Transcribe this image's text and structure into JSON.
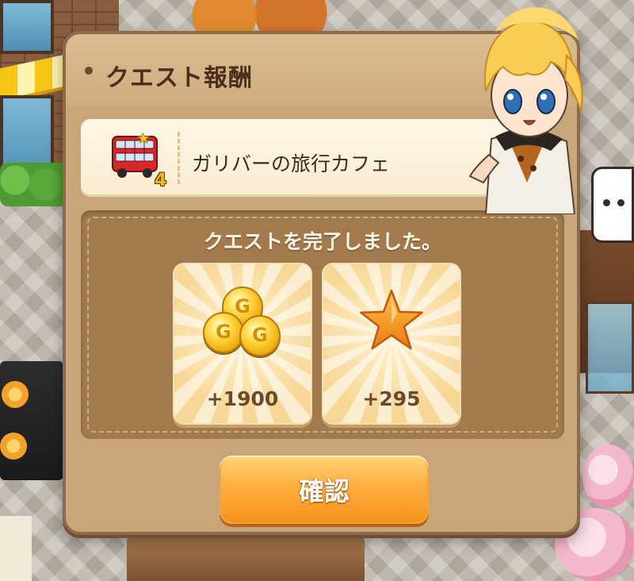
{
  "dialog": {
    "title": "クエスト報酬",
    "building": {
      "name": "ガリバーの旅行カフェ",
      "level": "4",
      "icon": "red-double-decker-bus-icon"
    },
    "message": "クエストを完了しました。",
    "rewards": [
      {
        "type": "coins",
        "icon": "gold-coins-icon",
        "value": "+1900"
      },
      {
        "type": "experience",
        "icon": "orange-star-icon",
        "value": "+295"
      }
    ],
    "confirm_label": "確認"
  },
  "coin_letter": "G",
  "colors": {
    "panel": "#c9a67a",
    "button": "#ffae3d",
    "title_text": "#4a2f1b",
    "level_badge": "#f0b70f"
  }
}
